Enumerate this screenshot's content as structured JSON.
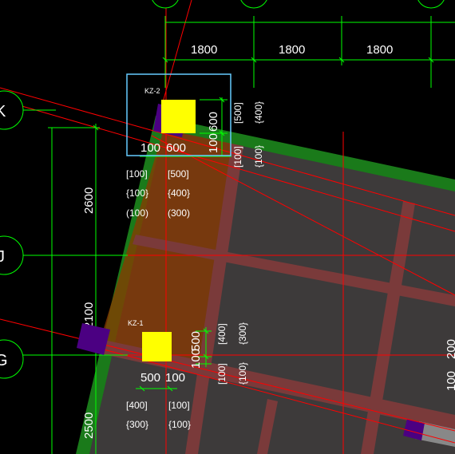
{
  "colors": {
    "background": "#000000",
    "grid_line": "#ff0000",
    "dimension_line": "#00ff00",
    "slab_fill": "#3d3a3a",
    "beam_fill": "#7a3a3a",
    "column": "#ffff00",
    "column_section": "#4b0082",
    "edge_band": "#1a7a1a",
    "highlight_fill": "#8b3a00",
    "selection_box": "#66ccff",
    "text": "#ffffff"
  },
  "axes": {
    "k": "K",
    "j": "J",
    "g": "G"
  },
  "top_dims": [
    "1800",
    "1800",
    "1800"
  ],
  "left_dims": [
    "2600",
    "2100",
    "2500"
  ],
  "right_dims": {
    "200": "200",
    "100": "100"
  },
  "kz2": {
    "tag": "KZ-2",
    "dim_100_left": "100",
    "dim_600_bottom": "600",
    "dim_100_bottom": "100",
    "dim_600_right": "600",
    "vert_500": "[500]",
    "vert_400": "{400}",
    "vert_100_sq": "[100]",
    "vert_100_br": "{100}",
    "row1_left": "[100]",
    "row1_right": "[500]",
    "row2_left": "{100}",
    "row2_right": "{400}",
    "row3_left": "(100)",
    "row3_right": "(300)"
  },
  "kz1": {
    "tag": "KZ-1",
    "dim_500_bottom": "500",
    "dim_100_bottom": "100",
    "dim_500_right": "500",
    "dim_100_right": "100",
    "vert_400": "[400]",
    "vert_300": "{300}",
    "vert_100_sq": "[100]",
    "vert_100_br": "{100}",
    "row1_left": "[400]",
    "row1_right": "[100]",
    "row2_left": "{300}",
    "row2_right": "{100}"
  }
}
